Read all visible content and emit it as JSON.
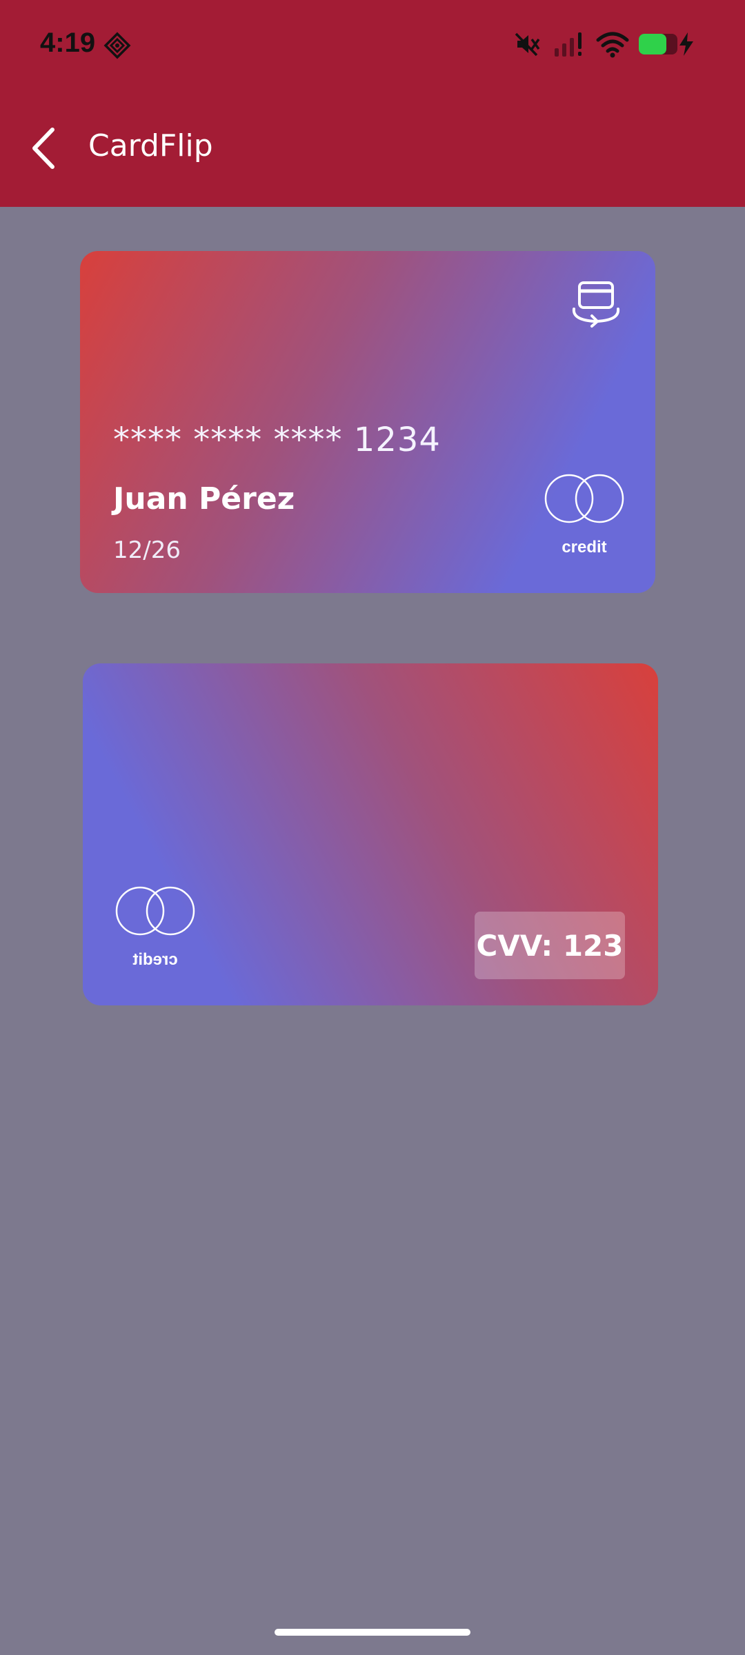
{
  "status_bar": {
    "time": "4:19",
    "icons": [
      "nfc-icon",
      "mute-icon",
      "signal-icon",
      "wifi-icon",
      "battery-icon",
      "charging-icon"
    ]
  },
  "header": {
    "title": "CardFlip",
    "back_icon": "chevron-left-icon",
    "background_color": "#a31c35"
  },
  "card_front": {
    "number": "**** **** **** 1234",
    "holder_name": "Juan Pérez",
    "expiry": "12/26",
    "brand_label": "credit",
    "flip_icon": "card-flip-icon"
  },
  "card_back": {
    "cvv": "CVV: 123",
    "brand_label": "credit"
  },
  "colors": {
    "gradient_red": "#d8403c",
    "gradient_purple": "#6a6ad8",
    "background": "#7d798e"
  }
}
